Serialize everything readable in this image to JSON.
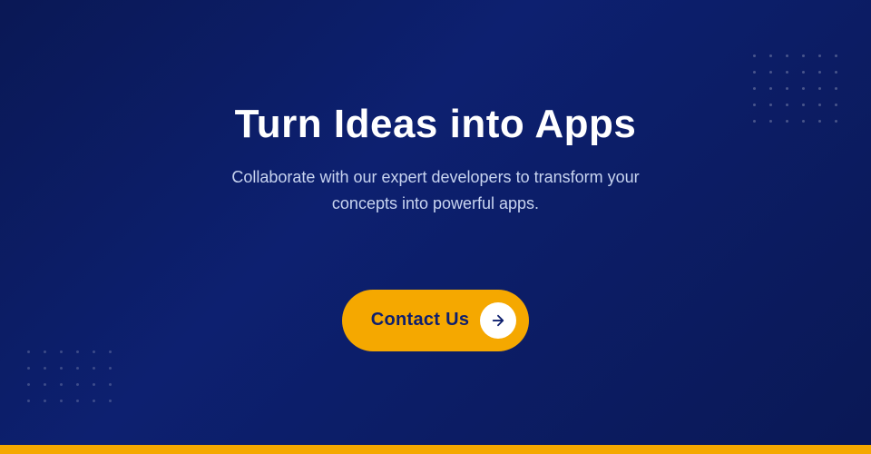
{
  "page": {
    "background_color": "#0a1855",
    "bottom_bar_color": "#F5A800"
  },
  "hero": {
    "title": "Turn Ideas into Apps",
    "subtitle": "Collaborate with our expert developers to transform your concepts into powerful apps.",
    "cta_button_label": "Contact Us",
    "cta_button_arrow": "→"
  },
  "dot_grids": {
    "top_right_count": 30,
    "bottom_left_count": 24
  }
}
